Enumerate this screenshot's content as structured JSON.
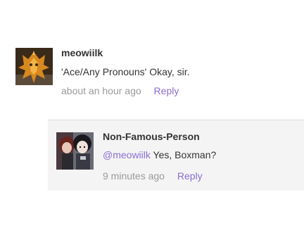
{
  "comments": [
    {
      "username": "meowiilk",
      "text": "'Ace/Any Pronouns' Okay, sir.",
      "timestamp": "about an hour ago",
      "reply_label": "Reply",
      "avatar_icon": "orange-creature-avatar-icon"
    },
    {
      "username": "Non-Famous-Person",
      "mention": "@meowiilk",
      "text": " Yes, Boxman?",
      "timestamp": "9 minutes ago",
      "reply_label": "Reply",
      "avatar_icon": "dark-haired-character-avatar-icon"
    }
  ],
  "colors": {
    "accent_link": "#8a6fd1",
    "text": "#333333",
    "meta": "#9a9a9a",
    "reply_background": "#f4f4f4"
  }
}
